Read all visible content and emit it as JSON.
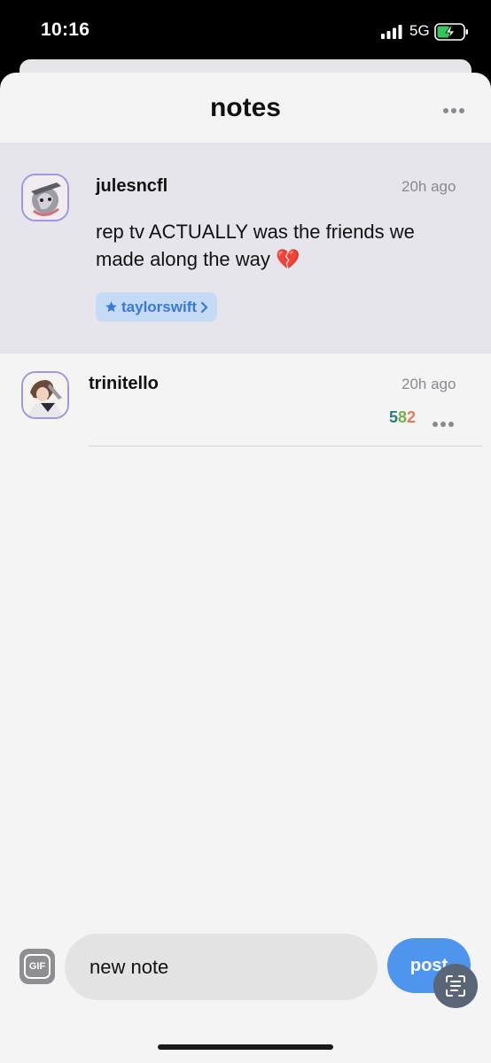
{
  "status_bar": {
    "time": "10:16",
    "network": "5G",
    "battery_icon": "battery-charging-icon",
    "signal_icon": "cellular-signal-icon"
  },
  "header": {
    "title": "notes",
    "more_icon": "more-horizontal-icon"
  },
  "notes": [
    {
      "username": "julesncfl",
      "time": "20h ago",
      "text": "rep tv ACTUALLY was the friends we made along the way 💔",
      "tag": {
        "icon": "star-icon",
        "label": "taylorswift",
        "chevron": "chevron-right-icon"
      }
    },
    {
      "username": "trinitello",
      "time": "20h ago",
      "count": [
        "5",
        "8",
        "2"
      ],
      "count_colors": [
        "#2e7d7a",
        "#76b04a",
        "#e77a5a"
      ],
      "more_icon": "more-horizontal-icon"
    }
  ],
  "composer": {
    "gif_label": "GIF",
    "placeholder": "new note",
    "post_label": "post",
    "scan_icon": "text-scan-icon"
  },
  "colors": {
    "accent": "#4f95ef",
    "tag_bg": "#c4daf5",
    "tag_text": "#3a78d8",
    "highlight_bg": "#e6e5ec",
    "sheet_bg": "#f4f4f5"
  }
}
